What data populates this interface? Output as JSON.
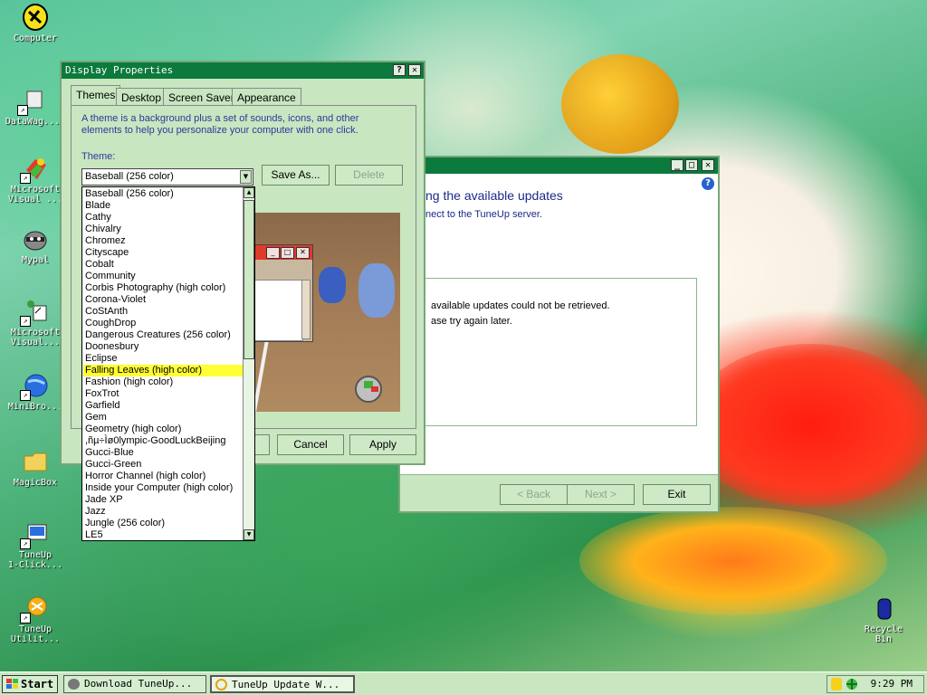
{
  "desktop": {
    "icons": [
      {
        "label": "Computer"
      },
      {
        "label": "DataWag..."
      },
      {
        "label": "Microsoft\nVisual ..."
      },
      {
        "label": "Mypal"
      },
      {
        "label": "Microsoft\nVisual..."
      },
      {
        "label": "MiniBro..."
      },
      {
        "label": "MagicBox"
      },
      {
        "label": "TuneUp\n1-Click..."
      },
      {
        "label": "TuneUp\nUtilit..."
      },
      {
        "label": "Recycle\nBin"
      }
    ]
  },
  "tuneup_window": {
    "heading": "ng the available updates",
    "subtitle": "nect to the TuneUp server.",
    "message_line1": "available updates could not be retrieved.",
    "message_line2": "ase try again later.",
    "back_label": "< Back",
    "next_label": "Next >",
    "exit_label": "Exit"
  },
  "display_props": {
    "title": "Display Properties",
    "help_btn": "?",
    "close_btn": "X",
    "tabs": [
      "Themes",
      "Desktop",
      "Screen Saver",
      "Appearance"
    ],
    "description": "A theme is a background plus a set of sounds, icons, and other elements to help you personalize your computer with one click.",
    "theme_label": "Theme:",
    "selected_theme": "Baseball (256 color)",
    "save_as_label": "Save As...",
    "delete_label": "Delete",
    "cancel_label": "Cancel",
    "apply_label": "Apply",
    "theme_options": [
      "Baseball (256 color)",
      "Blade",
      "Cathy",
      "Chivalry",
      "Chromez",
      "Cityscape",
      "Cobalt",
      "Community",
      "Corbis Photography (high color)",
      "Corona-Violet",
      "CoStAnth",
      "CoughDrop",
      "Dangerous Creatures (256 color)",
      "Doonesbury",
      "Eclipse",
      "Falling Leaves (high color)",
      "Fashion (high color)",
      "FoxTrot",
      "Garfield",
      "Gem",
      "Geometry (high color)",
      ",ñµ÷Ìø0lympic-GoodLuckBeijing",
      "Gucci-Blue",
      "Gucci-Green",
      "Horror Channel (high color)",
      "Inside your Computer (high color)",
      "Jade XP",
      "Jazz",
      "Jungle (256 color)",
      "LE5"
    ],
    "highlighted_option": "Falling Leaves (high color)"
  },
  "taskbar": {
    "start_label": "Start",
    "tasks": [
      {
        "label": "Download TuneUp..."
      },
      {
        "label": "TuneUp Update W..."
      }
    ],
    "clock": "9:29 PM"
  },
  "colors": {
    "title_bar": "#0c7a3c",
    "window_bg": "#c8e6c0",
    "selection": "#ffff33",
    "heading_blue": "#1a2a8a"
  }
}
